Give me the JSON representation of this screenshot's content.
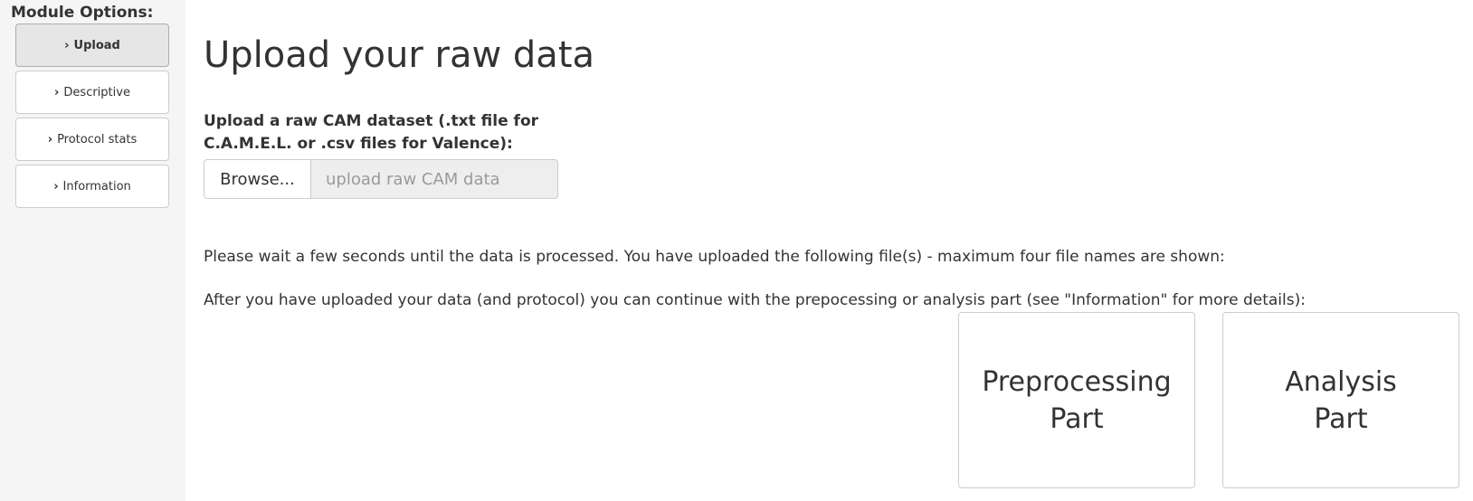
{
  "sidebar": {
    "title": "Module Options:",
    "items": [
      {
        "chevron": "›",
        "label": "Upload",
        "active": true
      },
      {
        "chevron": "›",
        "label": "Descriptive",
        "active": false
      },
      {
        "chevron": "›",
        "label": "Protocol stats",
        "active": false
      },
      {
        "chevron": "›",
        "label": "Information",
        "active": false
      }
    ]
  },
  "main": {
    "title": "Upload your raw data",
    "upload": {
      "label_line1": "Upload a raw CAM dataset (.txt file for",
      "label_line2": "C.A.M.E.L. or .csv files for Valence):",
      "browse_label": "Browse...",
      "placeholder": "upload raw CAM data"
    },
    "wait_text": "Please wait a few seconds until the data is processed. You have uploaded the following file(s) - maximum four file names are shown:",
    "continue_text": "After you have uploaded your data (and protocol) you can continue with the prepocessing or analysis part (see \"Information\" for more details):",
    "buttons": {
      "preprocessing_line1": "Preprocessing",
      "preprocessing_line2": "Part",
      "analysis_line1": "Analysis",
      "analysis_line2": "Part"
    }
  }
}
